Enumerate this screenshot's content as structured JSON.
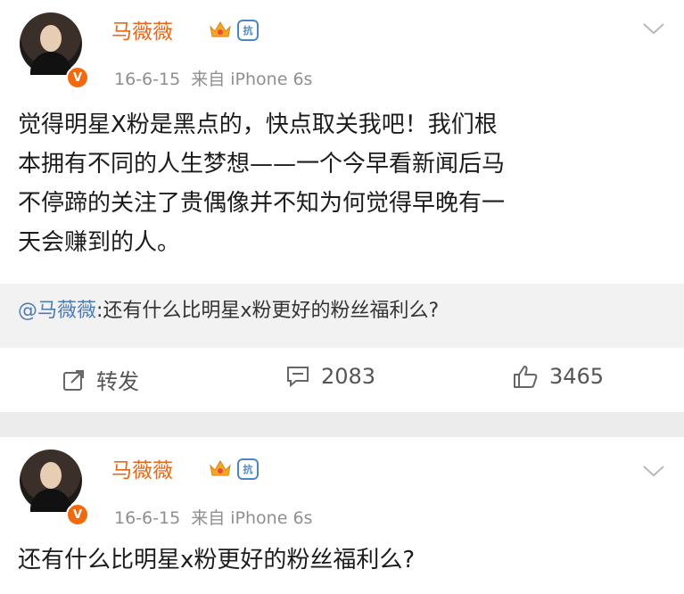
{
  "post1": {
    "author": "马薇薇",
    "badge_text": "抗",
    "verified": "V",
    "meta": "16-6-15  来自 iPhone 6s",
    "content_lines": [
      "觉得明星X粉是黑点的，快点取关我吧！我们根",
      "本拥有不同的人生梦想——一个今早看新闻后马",
      "不停蹄的关注了贵偶像并不知为何觉得早晚有一",
      "天会赚到的人。"
    ],
    "repost_at": "@马薇薇",
    "repost_body": ":还有什么比明星x粉更好的粉丝福利么?",
    "actions": {
      "forward_label": "转发",
      "comments": "2083",
      "likes": "3465"
    }
  },
  "post2": {
    "author": "马薇薇",
    "badge_text": "抗",
    "verified": "V",
    "meta": "16-6-15  来自 iPhone 6s",
    "content": "还有什么比明星x粉更好的粉丝福利么?"
  },
  "colors": {
    "name": "#e36a1a",
    "link": "#4f7bb5",
    "meta": "#8f8f8f",
    "repost_bg": "#f2f2f2",
    "divider": "#ececec"
  },
  "icons": [
    "crown-icon",
    "shield-badge-icon",
    "chevron-down-icon",
    "forward-icon",
    "comment-icon",
    "like-icon"
  ]
}
